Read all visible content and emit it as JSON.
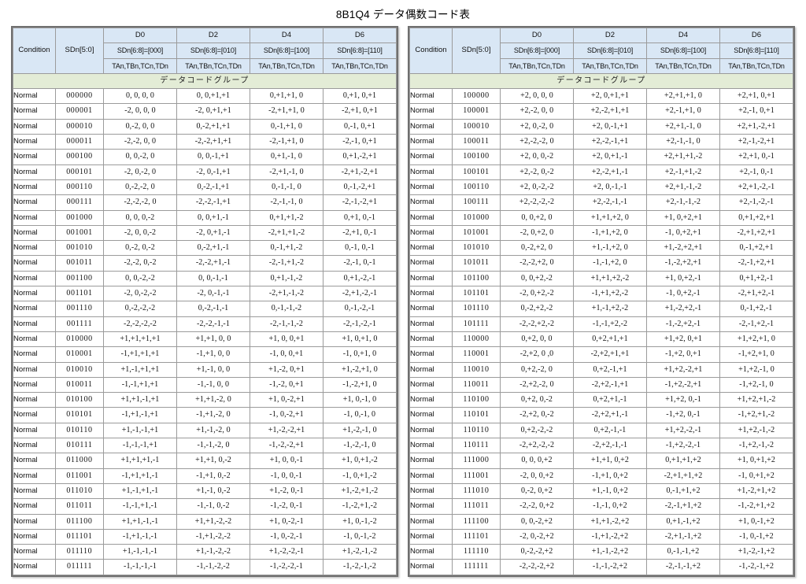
{
  "title": "8B1Q4 データ偶数コード表",
  "colors": {
    "header_bg": "#d9e7f5",
    "group_bg": "#e3ecd6",
    "frame_border": "#6f6f6f",
    "cell_border": "#9b9b9b"
  },
  "header": {
    "condition": "Condition",
    "sdn_range": "SDn[5:0]",
    "columns": [
      {
        "name": "D0",
        "sdn": "SDn[6:8]=[000]",
        "signals": "TAn,TBn,TCn,TDn"
      },
      {
        "name": "D2",
        "sdn": "SDn[6:8]=[010]",
        "signals": "TAn,TBn,TCn,TDn"
      },
      {
        "name": "D4",
        "sdn": "SDn[6:8]=[100]",
        "signals": "TAn,TBn,TCn,TDn"
      },
      {
        "name": "D6",
        "sdn": "SDn[6:8]=[110]",
        "signals": "TAn,TBn,TCn,TDn"
      }
    ],
    "group_label": "データコードグループ"
  },
  "tables": [
    {
      "id": "left-table",
      "rows": [
        {
          "condition": "Normal",
          "sdn": "000000",
          "cells": [
            " 0,  0,  0,  0",
            " 0,  0,+1,+1",
            " 0,+1,+1,  0",
            " 0,+1,  0,+1"
          ]
        },
        {
          "condition": "Normal",
          "sdn": "000001",
          "cells": [
            "-2,  0,  0,  0",
            "-2,  0,+1,+1",
            "-2,+1,+1,  0",
            "-2,+1,  0,+1"
          ]
        },
        {
          "condition": "Normal",
          "sdn": "000010",
          "cells": [
            " 0,-2,  0,  0",
            " 0,-2,+1,+1",
            " 0,-1,+1,  0",
            " 0,-1,  0,+1"
          ]
        },
        {
          "condition": "Normal",
          "sdn": "000011",
          "cells": [
            "-2,-2,  0,  0",
            "-2,-2,+1,+1",
            "-2,-1,+1,  0",
            "-2,-1,  0,+1"
          ]
        },
        {
          "condition": "Normal",
          "sdn": "000100",
          "cells": [
            " 0,  0,-2,  0",
            " 0,  0,-1,+1",
            " 0,+1,-1,  0",
            " 0,+1,-2,+1"
          ]
        },
        {
          "condition": "Normal",
          "sdn": "000101",
          "cells": [
            "-2,  0,-2,  0",
            "-2,  0,-1,+1",
            "-2,+1,-1,  0",
            "-2,+1,-2,+1"
          ]
        },
        {
          "condition": "Normal",
          "sdn": "000110",
          "cells": [
            " 0,-2,-2,  0",
            " 0,-2,-1,+1",
            " 0,-1,-1,  0",
            " 0,-1,-2,+1"
          ]
        },
        {
          "condition": "Normal",
          "sdn": "000111",
          "cells": [
            "-2,-2,-2,  0",
            "-2,-2,-1,+1",
            "-2,-1,-1,  0",
            "-2,-1,-2,+1"
          ]
        },
        {
          "condition": "Normal",
          "sdn": "001000",
          "cells": [
            " 0,  0,  0,-2",
            " 0,  0,+1,-1",
            " 0,+1,+1,-2",
            " 0,+1,  0,-1"
          ]
        },
        {
          "condition": "Normal",
          "sdn": "001001",
          "cells": [
            "-2,  0,  0,-2",
            "-2,  0,+1,-1",
            "-2,+1,+1,-2",
            "-2,+1,  0,-1"
          ]
        },
        {
          "condition": "Normal",
          "sdn": "001010",
          "cells": [
            " 0,-2,  0,-2",
            " 0,-2,+1,-1",
            " 0,-1,+1,-2",
            " 0,-1,  0,-1"
          ]
        },
        {
          "condition": "Normal",
          "sdn": "001011",
          "cells": [
            "-2,-2,  0,-2",
            "-2,-2,+1,-1",
            "-2,-1,+1,-2",
            "-2,-1,  0,-1"
          ]
        },
        {
          "condition": "Normal",
          "sdn": "001100",
          "cells": [
            " 0,  0,-2,-2",
            " 0,  0,-1,-1",
            " 0,+1,-1,-2",
            " 0,+1,-2,-1"
          ]
        },
        {
          "condition": "Normal",
          "sdn": "001101",
          "cells": [
            "-2,  0,-2,-2",
            "-2,  0,-1,-1",
            "-2,+1,-1,-2",
            "-2,+1,-2,-1"
          ]
        },
        {
          "condition": "Normal",
          "sdn": "001110",
          "cells": [
            " 0,-2,-2,-2",
            " 0,-2,-1,-1",
            " 0,-1,-1,-2",
            " 0,-1,-2,-1"
          ]
        },
        {
          "condition": "Normal",
          "sdn": "001111",
          "cells": [
            "-2,-2,-2,-2",
            "-2,-2,-1,-1",
            "-2,-1,-1,-2",
            "-2,-1,-2,-1"
          ]
        },
        {
          "condition": "Normal",
          "sdn": "010000",
          "cells": [
            "+1,+1,+1,+1",
            "+1,+1,  0,  0",
            "+1,  0,  0,+1",
            "+1,  0,+1,  0"
          ]
        },
        {
          "condition": "Normal",
          "sdn": "010001",
          "cells": [
            "-1,+1,+1,+1",
            "-1,+1,  0,  0",
            "-1,  0,  0,+1",
            "-1,  0,+1,  0"
          ]
        },
        {
          "condition": "Normal",
          "sdn": "010010",
          "cells": [
            "+1,-1,+1,+1",
            "+1,-1,  0,  0",
            "+1,-2,  0,+1",
            "+1,-2,+1,  0"
          ]
        },
        {
          "condition": "Normal",
          "sdn": "010011",
          "cells": [
            "-1,-1,+1,+1",
            "-1,-1,  0,  0",
            "-1,-2,  0,+1",
            "-1,-2,+1,  0"
          ]
        },
        {
          "condition": "Normal",
          "sdn": "010100",
          "cells": [
            "+1,+1,-1,+1",
            "+1,+1,-2,  0",
            "+1,  0,-2,+1",
            "+1,  0,-1,  0"
          ]
        },
        {
          "condition": "Normal",
          "sdn": "010101",
          "cells": [
            "-1,+1,-1,+1",
            "-1,+1,-2,  0",
            "-1,  0,-2,+1",
            "-1,  0,-1,  0"
          ]
        },
        {
          "condition": "Normal",
          "sdn": "010110",
          "cells": [
            "+1,-1,-1,+1",
            "+1,-1,-2,  0",
            "+1,-2,-2,+1",
            "+1,-2,-1,  0"
          ]
        },
        {
          "condition": "Normal",
          "sdn": "010111",
          "cells": [
            "-1,-1,-1,+1",
            "-1,-1,-2,  0",
            "-1,-2,-2,+1",
            "-1,-2,-1,  0"
          ]
        },
        {
          "condition": "Normal",
          "sdn": "011000",
          "cells": [
            "+1,+1,+1,-1",
            "+1,+1,  0,-2",
            "+1,  0,  0,-1",
            "+1,  0,+1,-2"
          ]
        },
        {
          "condition": "Normal",
          "sdn": "011001",
          "cells": [
            "-1,+1,+1,-1",
            "-1,+1,  0,-2",
            "-1,  0,  0,-1",
            "-1,  0,+1,-2"
          ]
        },
        {
          "condition": "Normal",
          "sdn": "011010",
          "cells": [
            "+1,-1,+1,-1",
            "+1,-1,  0,-2",
            "+1,-2,  0,-1",
            "+1,-2,+1,-2"
          ]
        },
        {
          "condition": "Normal",
          "sdn": "011011",
          "cells": [
            "-1,-1,+1,-1",
            "-1,-1,  0,-2",
            "-1,-2,  0,-1",
            "-1,-2,+1,-2"
          ]
        },
        {
          "condition": "Normal",
          "sdn": "011100",
          "cells": [
            "+1,+1,-1,-1",
            "+1,+1,-2,-2",
            "+1,  0,-2,-1",
            "+1,  0,-1,-2"
          ]
        },
        {
          "condition": "Normal",
          "sdn": "011101",
          "cells": [
            "-1,+1,-1,-1",
            "-1,+1,-2,-2",
            "-1,  0,-2,-1",
            "-1,  0,-1,-2"
          ]
        },
        {
          "condition": "Normal",
          "sdn": "011110",
          "cells": [
            "+1,-1,-1,-1",
            "+1,-1,-2,-2",
            "+1,-2,-2,-1",
            "+1,-2,-1,-2"
          ]
        },
        {
          "condition": "Normal",
          "sdn": "011111",
          "cells": [
            "-1,-1,-1,-1",
            "-1,-1,-2,-2",
            "-1,-2,-2,-1",
            "-1,-2,-1,-2"
          ]
        }
      ]
    },
    {
      "id": "right-table",
      "rows": [
        {
          "condition": "Normal",
          "sdn": "100000",
          "cells": [
            "+2,  0,  0,  0",
            "+2,  0,+1,+1",
            "+2,+1,+1,  0",
            "+2,+1,  0,+1"
          ]
        },
        {
          "condition": "Normal",
          "sdn": "100001",
          "cells": [
            "+2,-2,  0,  0",
            "+2,-2,+1,+1",
            "+2,-1,+1,  0",
            "+2,-1,  0,+1"
          ]
        },
        {
          "condition": "Normal",
          "sdn": "100010",
          "cells": [
            "+2,  0,-2,  0",
            "+2,  0,-1,+1",
            "+2,+1,-1,  0",
            "+2,+1,-2,+1"
          ]
        },
        {
          "condition": "Normal",
          "sdn": "100011",
          "cells": [
            "+2,-2,-2,  0",
            "+2,-2,-1,+1",
            "+2,-1,-1,  0",
            "+2,-1,-2,+1"
          ]
        },
        {
          "condition": "Normal",
          "sdn": "100100",
          "cells": [
            "+2,  0,  0,-2",
            "+2,  0,+1,-1",
            "+2,+1,+1,-2",
            "+2,+1,  0,-1"
          ]
        },
        {
          "condition": "Normal",
          "sdn": "100101",
          "cells": [
            "+2,-2,  0,-2",
            "+2,-2,+1,-1",
            "+2,-1,+1,-2",
            "+2,-1,  0,-1"
          ]
        },
        {
          "condition": "Normal",
          "sdn": "100110",
          "cells": [
            "+2,  0,-2,-2",
            "+2,  0,-1,-1",
            "+2,+1,-1,-2",
            "+2,+1,-2,-1"
          ]
        },
        {
          "condition": "Normal",
          "sdn": "100111",
          "cells": [
            "+2,-2,-2,-2",
            "+2,-2,-1,-1",
            "+2,-1,-1,-2",
            "+2,-1,-2,-1"
          ]
        },
        {
          "condition": "Normal",
          "sdn": "101000",
          "cells": [
            " 0,  0,+2,  0",
            "+1,+1,+2,  0",
            "+1,  0,+2,+1",
            " 0,+1,+2,+1"
          ]
        },
        {
          "condition": "Normal",
          "sdn": "101001",
          "cells": [
            "-2,  0,+2,  0",
            "-1,+1,+2,  0",
            "-1,  0,+2,+1",
            "-2,+1,+2,+1"
          ]
        },
        {
          "condition": "Normal",
          "sdn": "101010",
          "cells": [
            " 0,-2,+2,  0",
            "+1,-1,+2,  0",
            "+1,-2,+2,+1",
            " 0,-1,+2,+1"
          ]
        },
        {
          "condition": "Normal",
          "sdn": "101011",
          "cells": [
            "-2,-2,+2,  0",
            "-1,-1,+2,  0",
            "-1,-2,+2,+1",
            "-2,-1,+2,+1"
          ]
        },
        {
          "condition": "Normal",
          "sdn": "101100",
          "cells": [
            " 0,  0,+2,-2",
            "+1,+1,+2,-2",
            "+1,  0,+2,-1",
            " 0,+1,+2,-1"
          ]
        },
        {
          "condition": "Normal",
          "sdn": "101101",
          "cells": [
            "-2,  0,+2,-2",
            "-1,+1,+2,-2",
            "-1,  0,+2,-1",
            "-2,+1,+2,-1"
          ]
        },
        {
          "condition": "Normal",
          "sdn": "101110",
          "cells": [
            " 0,-2,+2,-2",
            "+1,-1,+2,-2",
            "+1,-2,+2,-1",
            " 0,-1,+2,-1"
          ]
        },
        {
          "condition": "Normal",
          "sdn": "101111",
          "cells": [
            "-2,-2,+2,-2",
            "-1,-1,+2,-2",
            "-1,-2,+2,-1",
            "-2,-1,+2,-1"
          ]
        },
        {
          "condition": "Normal",
          "sdn": "110000",
          "cells": [
            " 0,+2,  0,  0",
            " 0,+2,+1,+1",
            "+1,+2,  0,+1",
            "+1,+2,+1,  0"
          ]
        },
        {
          "condition": "Normal",
          "sdn": "110001",
          "cells": [
            "-2,+2,  0 ,0",
            "-2,+2,+1,+1",
            "-1,+2,  0,+1",
            "-1,+2,+1,  0"
          ]
        },
        {
          "condition": "Normal",
          "sdn": "110010",
          "cells": [
            " 0,+2,-2,  0",
            " 0,+2,-1,+1",
            "+1,+2,-2,+1",
            "+1,+2,-1,  0"
          ]
        },
        {
          "condition": "Normal",
          "sdn": "110011",
          "cells": [
            "-2,+2,-2,  0",
            "-2,+2,-1,+1",
            "-1,+2,-2,+1",
            "-1,+2,-1,  0"
          ]
        },
        {
          "condition": "Normal",
          "sdn": "110100",
          "cells": [
            " 0,+2,  0,-2",
            " 0,+2,+1,-1",
            "+1,+2,  0,-1",
            "+1,+2,+1,-2"
          ]
        },
        {
          "condition": "Normal",
          "sdn": "110101",
          "cells": [
            "-2,+2,  0,-2",
            "-2,+2,+1,-1",
            "-1,+2,  0,-1",
            "-1,+2,+1,-2"
          ]
        },
        {
          "condition": "Normal",
          "sdn": "110110",
          "cells": [
            " 0,+2,-2,-2",
            " 0,+2,-1,-1",
            "+1,+2,-2,-1",
            "+1,+2,-1,-2"
          ]
        },
        {
          "condition": "Normal",
          "sdn": "110111",
          "cells": [
            "-2,+2,-2,-2",
            "-2,+2,-1,-1",
            "-1,+2,-2,-1",
            "-1,+2,-1,-2"
          ]
        },
        {
          "condition": "Normal",
          "sdn": "111000",
          "cells": [
            " 0,  0,  0,+2",
            "+1,+1,  0,+2",
            " 0,+1,+1,+2",
            "+1,  0,+1,+2"
          ]
        },
        {
          "condition": "Normal",
          "sdn": "111001",
          "cells": [
            "-2,  0,  0,+2",
            "-1,+1,  0,+2",
            "-2,+1,+1,+2",
            "-1,  0,+1,+2"
          ]
        },
        {
          "condition": "Normal",
          "sdn": "111010",
          "cells": [
            " 0,-2,  0,+2",
            "+1,-1,  0,+2",
            " 0,-1,+1,+2",
            "+1,-2,+1,+2"
          ]
        },
        {
          "condition": "Normal",
          "sdn": "111011",
          "cells": [
            "-2,-2,  0,+2",
            "-1,-1,  0,+2",
            "-2,-1,+1,+2",
            "-1,-2,+1,+2"
          ]
        },
        {
          "condition": "Normal",
          "sdn": "111100",
          "cells": [
            " 0,  0,-2,+2",
            "+1,+1,-2,+2",
            " 0,+1,-1,+2",
            "+1,  0,-1,+2"
          ]
        },
        {
          "condition": "Normal",
          "sdn": "111101",
          "cells": [
            "-2,  0,-2,+2",
            "-1,+1,-2,+2",
            "-2,+1,-1,+2",
            "-1,  0,-1,+2"
          ]
        },
        {
          "condition": "Normal",
          "sdn": "111110",
          "cells": [
            " 0,-2,-2,+2",
            "+1,-1,-2,+2",
            " 0,-1,-1,+2",
            "+1,-2,-1,+2"
          ]
        },
        {
          "condition": "Normal",
          "sdn": "111111",
          "cells": [
            "-2,-2,-2,+2",
            "-1,-1,-2,+2",
            "-2,-1,-1,+2",
            "-1,-2,-1,+2"
          ]
        }
      ]
    }
  ]
}
